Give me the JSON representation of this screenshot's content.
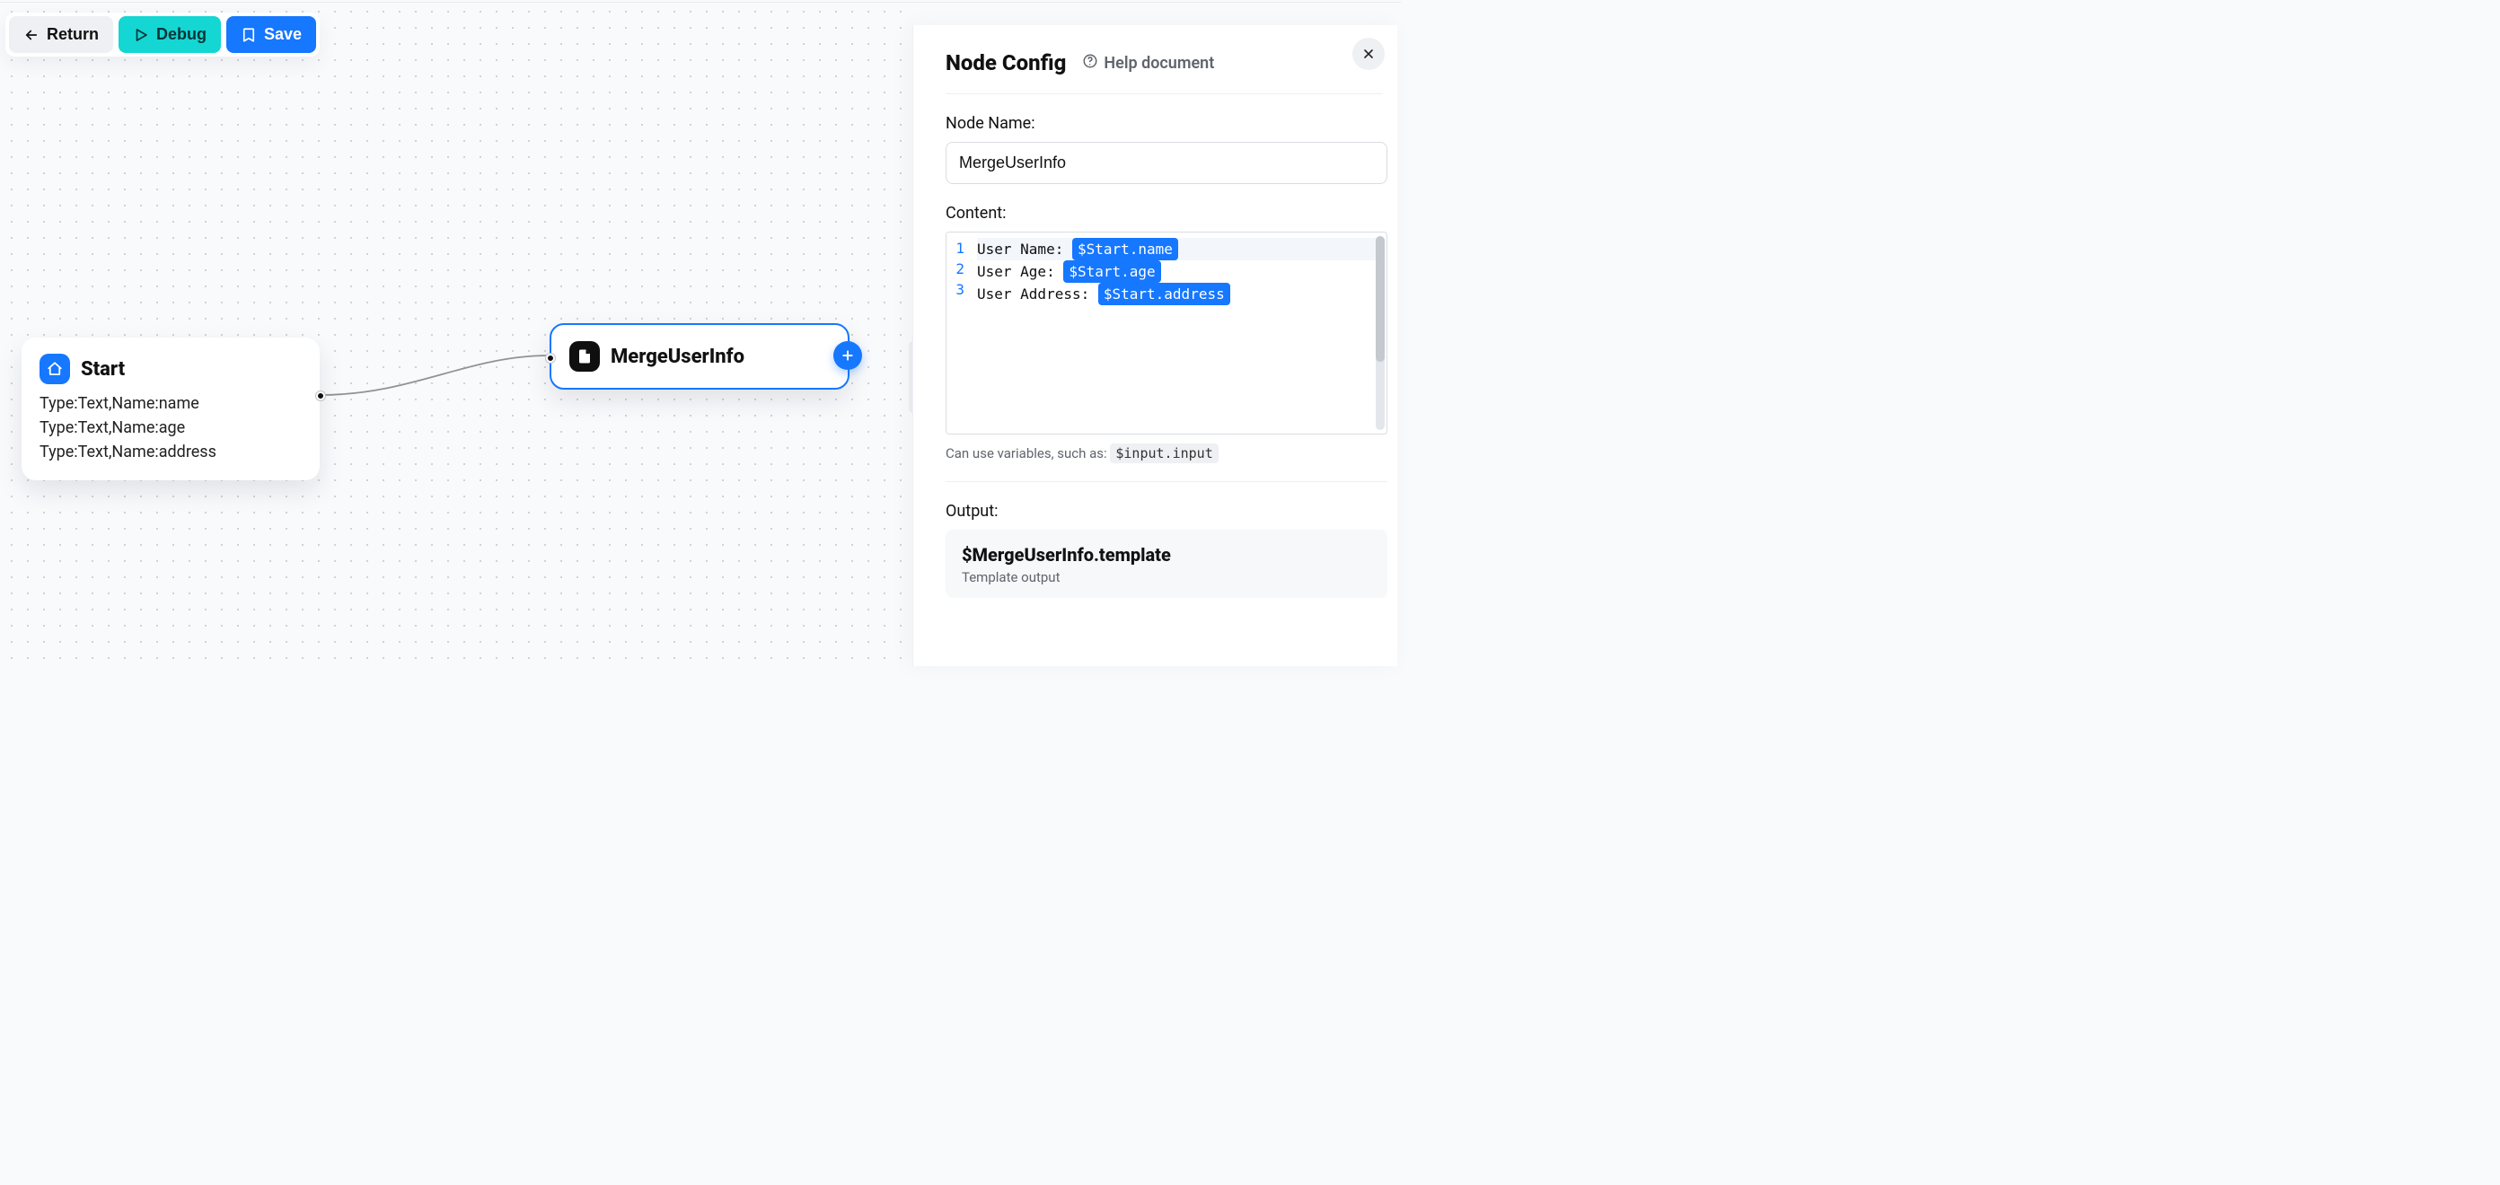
{
  "toolbar": {
    "return_label": "Return",
    "debug_label": "Debug",
    "save_label": "Save"
  },
  "nodes": {
    "start": {
      "title": "Start",
      "params": [
        "Type:Text,Name:name",
        "Type:Text,Name:age",
        "Type:Text,Name:address"
      ]
    },
    "merge": {
      "title": "MergeUserInfo"
    }
  },
  "panel": {
    "title": "Node Config",
    "help_label": "Help document",
    "node_name_label": "Node Name:",
    "node_name_value": "MergeUserInfo",
    "content_label": "Content:",
    "lines": [
      {
        "n": "1",
        "text": "User Name: ",
        "var": "$Start.name"
      },
      {
        "n": "2",
        "text": "User Age: ",
        "var": "$Start.age"
      },
      {
        "n": "3",
        "text": "User Address: ",
        "var": "$Start.address"
      }
    ],
    "hint_prefix": "Can use variables, such as:",
    "hint_token": "$input.input",
    "output_label": "Output:",
    "output_var": "$MergeUserInfo.template",
    "output_desc": "Template output"
  }
}
